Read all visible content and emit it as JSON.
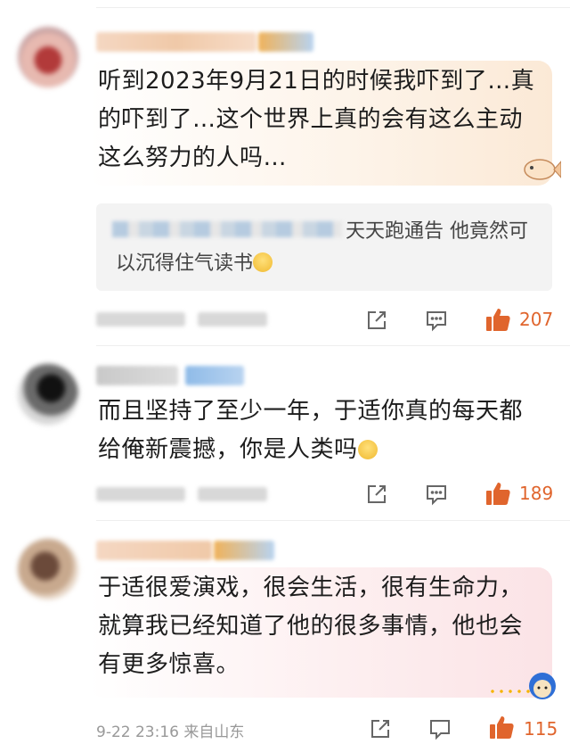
{
  "comments": [
    {
      "text": "听到2023年9月21日的时候我吓到了…真的吓到了…这个世界上真的会有这么主动这么努力的人吗…",
      "reply_tail": "天天跑通告 他竟然可以沉得住气读书",
      "likes": "207"
    },
    {
      "text": "而且坚持了至少一年，于适你真的每天都给俺新震撼，你是人类吗",
      "likes": "189"
    },
    {
      "text": "于适很爱演戏，很会生活，很有生命力，就算我已经知道了他的很多事情，他也会有更多惊喜。",
      "meta": "9-22 23:16 来自山东",
      "likes": "115"
    }
  ],
  "colors": {
    "accent": "#e0652d",
    "bubble_warm": "#fdf1e6",
    "quote_bg": "#f3f3f3"
  }
}
